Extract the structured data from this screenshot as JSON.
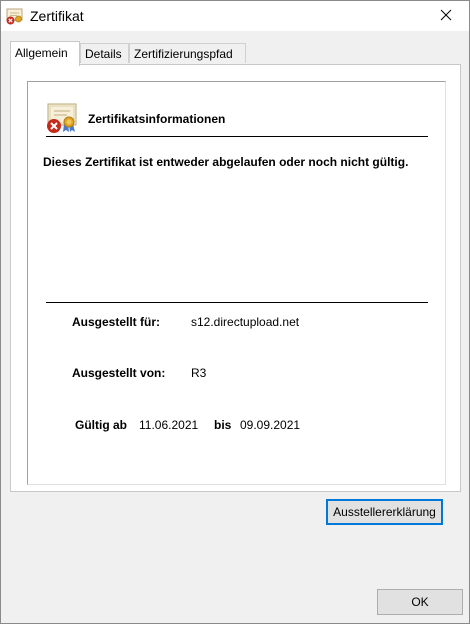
{
  "window": {
    "title": "Zertifikat"
  },
  "tabs": [
    {
      "label": "Allgemein",
      "active": true
    },
    {
      "label": "Details",
      "active": false
    },
    {
      "label": "Zertifizierungspfad",
      "active": false
    }
  ],
  "info": {
    "heading": "Zertifikatsinformationen",
    "warning": "Dieses Zertifikat ist entweder abgelaufen oder noch nicht gültig."
  },
  "fields": {
    "issued_to_label": "Ausgestellt für:",
    "issued_to_value": "s12.directupload.net",
    "issued_by_label": "Ausgestellt von:",
    "issued_by_value": "R3",
    "valid_from_label": "Gültig ab",
    "valid_from_value": "11.06.2021",
    "valid_to_label": "bis",
    "valid_to_value": "09.09.2021"
  },
  "buttons": {
    "issuer_statement": "Ausstellererklärung",
    "ok": "OK"
  },
  "icons": {
    "title": "certificate-error-icon",
    "close": "close-icon",
    "info": "certificate-error-icon"
  },
  "colors": {
    "error_red": "#c42b1c",
    "focus_blue": "#0078d7",
    "seal_gold": "#e0a526"
  }
}
